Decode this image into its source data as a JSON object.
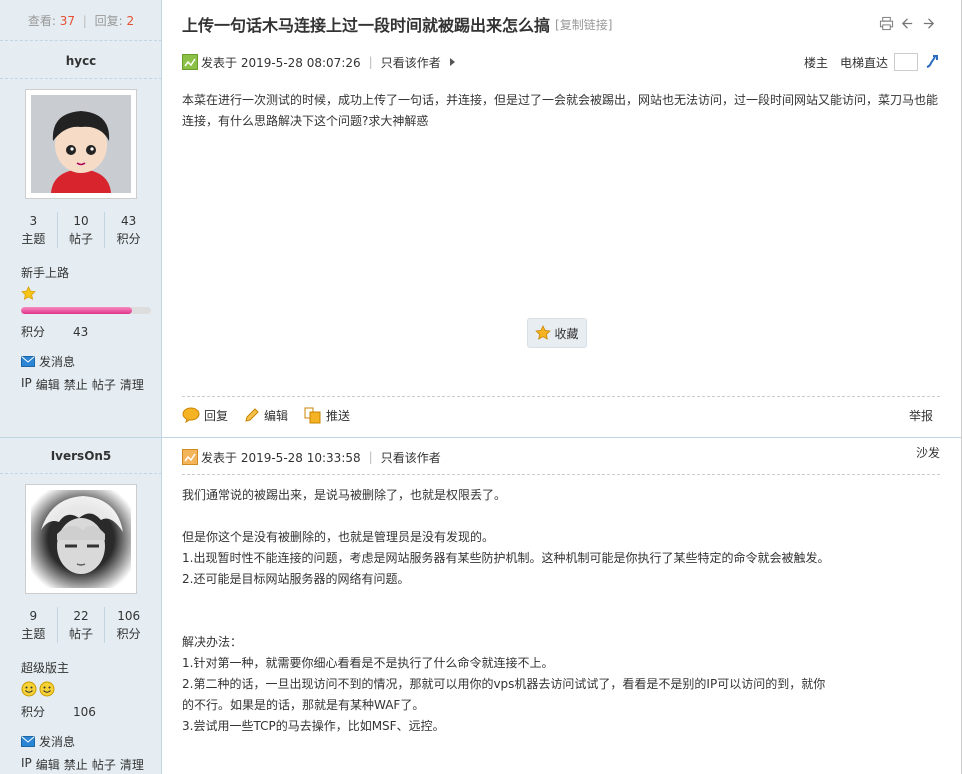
{
  "thread": {
    "views_label": "查看:",
    "views": "37",
    "sep": "|",
    "replies_label": "回复:",
    "replies": "2",
    "title": "上传一句话木马连接上过一段时间就被踢出来怎么搞",
    "copy_link": "[复制链接]"
  },
  "posts": [
    {
      "author": "hycc",
      "stats": [
        {
          "num": "3",
          "label": "主题"
        },
        {
          "num": "10",
          "label": "帖子"
        },
        {
          "num": "43",
          "label": "积分"
        }
      ],
      "rank": "新手上路",
      "progress": 0.85,
      "score_label": "积分",
      "score": "43",
      "send_msg": "发消息",
      "admin": [
        "IP",
        "编辑",
        "禁止",
        "帖子",
        "清理"
      ],
      "posted_at": "发表于 2019-5-28 08:07:26",
      "only_author": "只看该作者",
      "floor": "楼主",
      "jump_label": "电梯直达",
      "content": [
        "本菜在进行一次测试的时候，成功上传了一句话，并连接，但是过了一会就会被踢出，网站也无法访问，过一段时间网站又能访问，菜刀马也能连接，有什么思路解决下这个问题?求大神解惑"
      ],
      "favorite": "收藏",
      "actions": {
        "reply": "回复",
        "edit": "编辑",
        "recommend": "推送",
        "report": "举报"
      }
    },
    {
      "author": "IversOn5",
      "stats": [
        {
          "num": "9",
          "label": "主题"
        },
        {
          "num": "22",
          "label": "帖子"
        },
        {
          "num": "106",
          "label": "积分"
        }
      ],
      "rank": "超级版主",
      "score_label": "积分",
      "score": "106",
      "send_msg": "发消息",
      "admin": [
        "IP",
        "编辑",
        "禁止",
        "帖子",
        "清理"
      ],
      "posted_at": "发表于 2019-5-28 10:33:58",
      "only_author": "只看该作者",
      "floor": "沙发",
      "content": [
        "我们通常说的被踢出来，是说马被删除了，也就是权限丢了。",
        "",
        "但是你这个是没有被删除的，也就是管理员是没有发现的。",
        "1.出现暂时性不能连接的问题，考虑是网站服务器有某些防护机制。这种机制可能是你执行了某些特定的命令就会被触发。",
        "2.还可能是目标网站服务器的网络有问题。",
        "",
        "",
        "解决办法：",
        "1.针对第一种，就需要你细心看看是不是执行了什么命令就连接不上。",
        "2.第二种的话，一旦出现访问不到的情况，那就可以用你的vps机器去访问试试了，看看是不是别的IP可以访问的到，就你",
        "的不行。如果是的话，那就是有某种WAF了。",
        "3.尝试用一些TCP的马去操作，比如MSF、远控。"
      ]
    }
  ],
  "colors": {
    "accent_red": "#e64e33",
    "sidebar_bg": "#e5edf2",
    "progress": "#e0338a"
  },
  "icons": [
    "print-icon",
    "prev-thread-icon",
    "next-thread-icon",
    "post-status-icon",
    "arrow-right-icon",
    "jump-go-icon",
    "star-icon",
    "smiley-icon",
    "mail-icon",
    "reply-icon",
    "edit-icon",
    "recommend-icon"
  ]
}
